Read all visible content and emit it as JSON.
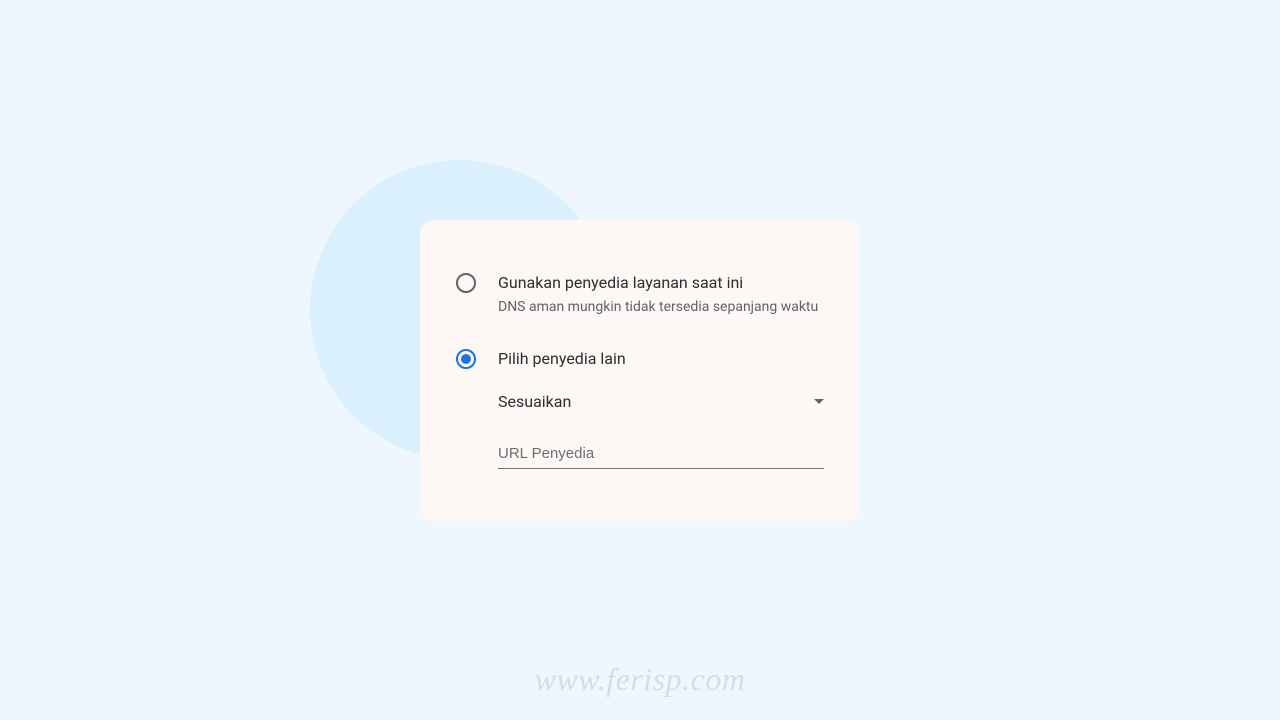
{
  "options": {
    "current": {
      "label": "Gunakan penyedia layanan saat ini",
      "sublabel": "DNS aman mungkin tidak tersedia sepanjang waktu",
      "selected": false
    },
    "other": {
      "label": "Pilih penyedia lain",
      "selected": true
    }
  },
  "dropdown": {
    "selected": "Sesuaikan"
  },
  "url_input": {
    "placeholder": "URL Penyedia"
  },
  "watermark": "www.ferisp.com"
}
